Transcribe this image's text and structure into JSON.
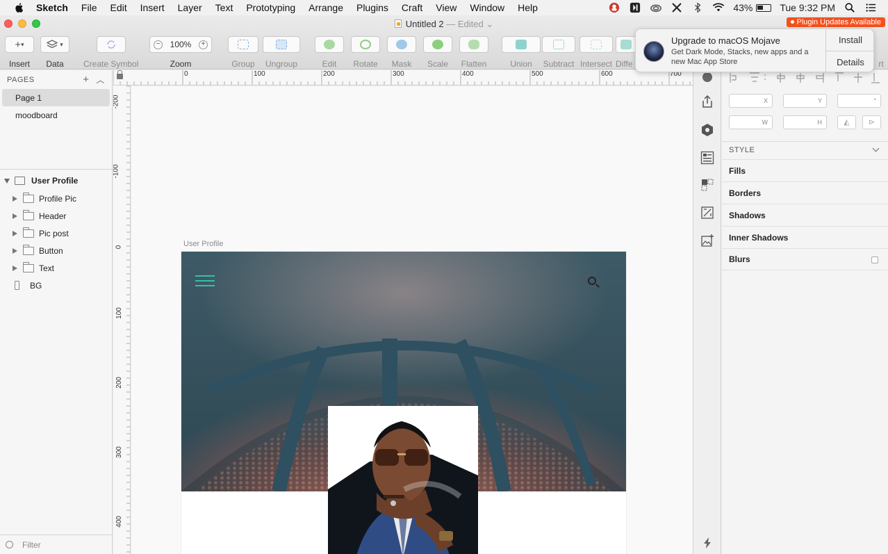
{
  "menubar": {
    "app": "Sketch",
    "items": [
      "File",
      "Edit",
      "Insert",
      "Layer",
      "Text",
      "Prototyping",
      "Arrange",
      "Plugins",
      "Craft",
      "View",
      "Window",
      "Help"
    ],
    "battery": "43%",
    "clock": "Tue 9:32 PM"
  },
  "window": {
    "title": "Untitled 2",
    "status": "— Edited",
    "plugin_badge": "Plugin Updates Available"
  },
  "toolbar": {
    "insert": "Insert",
    "data": "Data",
    "create_symbol": "Create Symbol",
    "zoom": "Zoom",
    "zoom_value": "100%",
    "group": "Group",
    "ungroup": "Ungroup",
    "edit": "Edit",
    "rotate": "Rotate",
    "mask": "Mask",
    "scale": "Scale",
    "flatten": "Flatten",
    "union": "Union",
    "subtract": "Subtract",
    "intersect": "Intersect",
    "difference": "Diffe",
    "export_partial": "rt"
  },
  "pages": {
    "header": "PAGES",
    "items": [
      "Page 1",
      "moodboard"
    ]
  },
  "layers": {
    "artboard": "User Profile",
    "items": [
      "Profile Pic",
      "Header",
      "Pic post",
      "Button",
      "Text",
      "BG"
    ]
  },
  "filter": {
    "label": "Filter"
  },
  "ruler": {
    "h": [
      "0",
      "100",
      "200",
      "300",
      "400",
      "500",
      "600",
      "700"
    ],
    "v": [
      "-200",
      "-100",
      "0",
      "100",
      "200",
      "300",
      "400"
    ]
  },
  "canvas": {
    "artboard_label": "User Profile"
  },
  "inspector": {
    "x": "X",
    "y": "Y",
    "deg": "°",
    "w": "W",
    "h": "H",
    "style": "STYLE",
    "sections": [
      "Fills",
      "Borders",
      "Shadows",
      "Inner Shadows",
      "Blurs"
    ]
  },
  "notification": {
    "title": "Upgrade to macOS Mojave",
    "body": "Get Dark Mode, Stacks, new apps and a new Mac App Store",
    "install": "Install",
    "details": "Details"
  },
  "colors": {
    "accent": "#f4511e",
    "hamburger": "#37d0b4"
  }
}
